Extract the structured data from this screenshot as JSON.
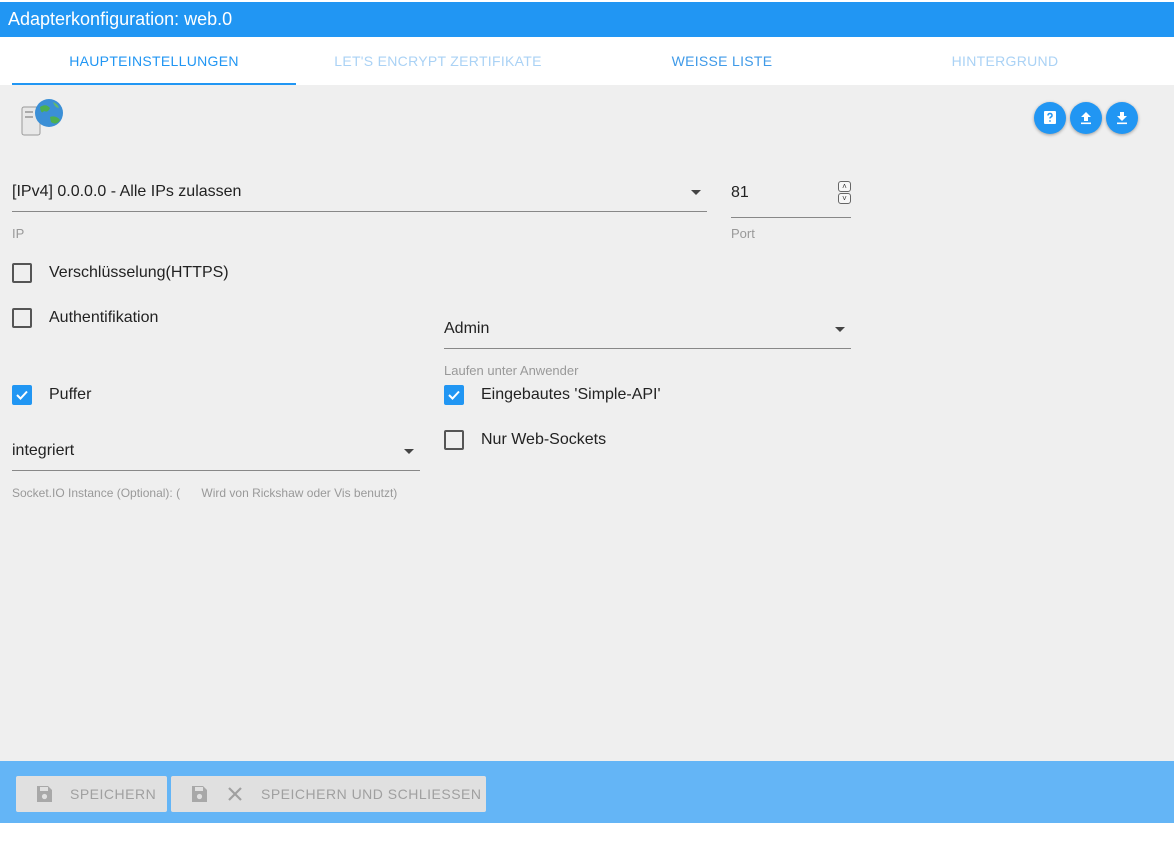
{
  "window": {
    "title": "Adapterkonfiguration: web.0"
  },
  "tabs": [
    {
      "label": "Haupteinstellungen",
      "state": "active"
    },
    {
      "label": "Let's Encrypt Zertifikate",
      "state": "disabled"
    },
    {
      "label": "Weisse Liste",
      "state": "normal"
    },
    {
      "label": "Hintergrund",
      "state": "disabled"
    }
  ],
  "toolbar": {
    "icons": [
      "help-icon",
      "upload-icon",
      "download-icon"
    ]
  },
  "form": {
    "ip": {
      "value": "[IPv4] 0.0.0.0 - Alle IPs zulassen",
      "label": "IP"
    },
    "port": {
      "value": "81",
      "label": "Port"
    },
    "https": {
      "label": "Verschlüsselung(HTTPS)",
      "checked": false
    },
    "auth": {
      "label": "Authentifikation",
      "checked": false
    },
    "run_as": {
      "value": "Admin",
      "label": "Laufen unter Anwender"
    },
    "cache": {
      "label": "Puffer",
      "checked": true
    },
    "simple_api": {
      "label": "Eingebautes 'Simple-API'",
      "checked": true
    },
    "web_sockets": {
      "label": "Nur Web-Sockets",
      "checked": false
    },
    "socketio": {
      "value": "integriert",
      "label": "Socket.IO Instance (Optional): (",
      "label_extra": "Wird von Rickshaw oder Vis benutzt)"
    }
  },
  "footer": {
    "save_label": "Speichern",
    "save_close_label": "Speichern und schliessen"
  },
  "colors": {
    "primary": "#2196f3",
    "footer": "#64b5f6",
    "content_bg": "#efefef"
  }
}
